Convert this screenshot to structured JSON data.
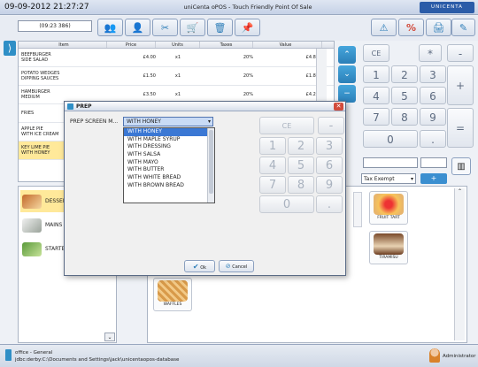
{
  "window": {
    "datetime": "09-09-2012 21:27:27",
    "title": "uniCenta oPOS - Touch Friendly Point Of Sale",
    "logo": "UNICENTA"
  },
  "ticket": {
    "number": "(09:23 386)"
  },
  "table": {
    "headers": [
      "Item",
      "Price",
      "Units",
      "Taxes",
      "Value"
    ],
    "rows": [
      {
        "item": [
          "BEEFBURGER",
          "SIDE SALAD"
        ],
        "price": "£4.00",
        "units": "x1",
        "taxes": "20%",
        "value": "£4.80",
        "selected": false
      },
      {
        "item": [
          "POTATO WEDGES",
          "DIPPING SAUCES"
        ],
        "price": "£1.50",
        "units": "x1",
        "taxes": "20%",
        "value": "£1.80",
        "selected": false
      },
      {
        "item": [
          "HAMBURGER",
          "MEDIUM"
        ],
        "price": "£3.50",
        "units": "x1",
        "taxes": "20%",
        "value": "£4.20",
        "selected": false
      },
      {
        "item": [
          "FRIES",
          ""
        ],
        "price": "",
        "units": "",
        "taxes": "",
        "value": "",
        "selected": false
      },
      {
        "item": [
          "APPLE PIE",
          "WITH ICE CREAM"
        ],
        "price": "",
        "units": "",
        "taxes": "",
        "value": "",
        "selected": false
      },
      {
        "item": [
          "KEY LIME PIE",
          "WITH HONEY"
        ],
        "price": "",
        "units": "",
        "taxes": "",
        "value": "",
        "selected": true
      }
    ]
  },
  "keypad": {
    "ce": "CE",
    "mul": "*",
    "minus": "-",
    "plus": "+",
    "eq": "=",
    "dot": ".",
    "digits": [
      "1",
      "2",
      "3",
      "4",
      "5",
      "6",
      "7",
      "8",
      "9",
      "0"
    ]
  },
  "tax": {
    "selected": "Tax Exempt",
    "plus": "+"
  },
  "categories": [
    {
      "label": "DESSERTS",
      "selected": true
    },
    {
      "label": "MAINS",
      "selected": false
    },
    {
      "label": "STARTERS",
      "selected": false
    }
  ],
  "products": [
    {
      "label": "FRUIT TART"
    },
    {
      "label": "TIRAMISU"
    },
    {
      "label": "WAFFLES"
    }
  ],
  "status": {
    "line1": "office - General",
    "line2": "jdbc:derby:C:\\Documents and Settings\\jack\\unicentaopos-database",
    "user": "Administrator"
  },
  "dialog": {
    "title": "PREP",
    "label": "PREP SCREEN M...",
    "selected": "WITH HONEY",
    "options": [
      "WITH HONEY",
      "WITH MAPLE SYRUP",
      "WITH DRESSING",
      "WITH SALSA",
      "WITH MAYO",
      "WITH BUTTER",
      "WITH WHITE BREAD",
      "WITH BROWN BREAD"
    ],
    "ok": "Ok",
    "cancel": "Cancel",
    "ce": "CE",
    "minus": "-",
    "dot": ".",
    "digits": [
      "1",
      "2",
      "3",
      "4",
      "5",
      "6",
      "7",
      "8",
      "9",
      "0"
    ]
  },
  "colors": {
    "accent": "#2f8fc6",
    "selected": "#ffe99a",
    "danger": "#d24b3b"
  }
}
